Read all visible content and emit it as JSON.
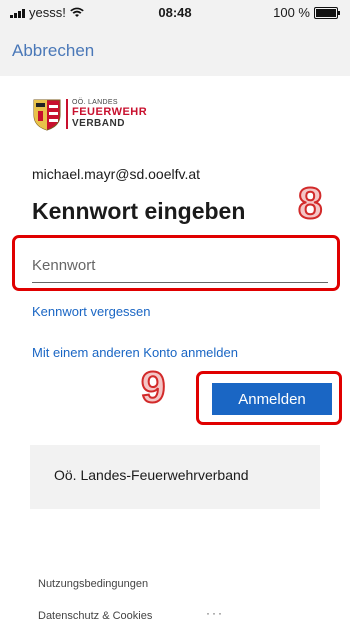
{
  "status_bar": {
    "carrier": "yesss!",
    "time": "08:48",
    "battery": "100 %"
  },
  "nav": {
    "cancel": "Abbrechen"
  },
  "logo": {
    "small": "OÖ. LANDES",
    "main": "FEUERWEHR",
    "sub": "VERBAND"
  },
  "account": {
    "email": "michael.mayr@sd.ooelfv.at"
  },
  "heading": "Kennwort eingeben",
  "password": {
    "placeholder": "Kennwort",
    "value": ""
  },
  "links": {
    "forgot": "Kennwort vergessen",
    "other_account": "Mit einem anderen Konto anmelden"
  },
  "signin_button": "Anmelden",
  "annotations": {
    "step_password": "8",
    "step_signin": "9"
  },
  "organization": "Oö. Landes-Feuerwehrverband",
  "footer": {
    "terms": "Nutzungsbedingungen",
    "privacy": "Datenschutz & Cookies",
    "more": "···"
  },
  "colors": {
    "accent": "#1a66c4",
    "annotation": "#e00000",
    "brand": "#c8102e"
  }
}
